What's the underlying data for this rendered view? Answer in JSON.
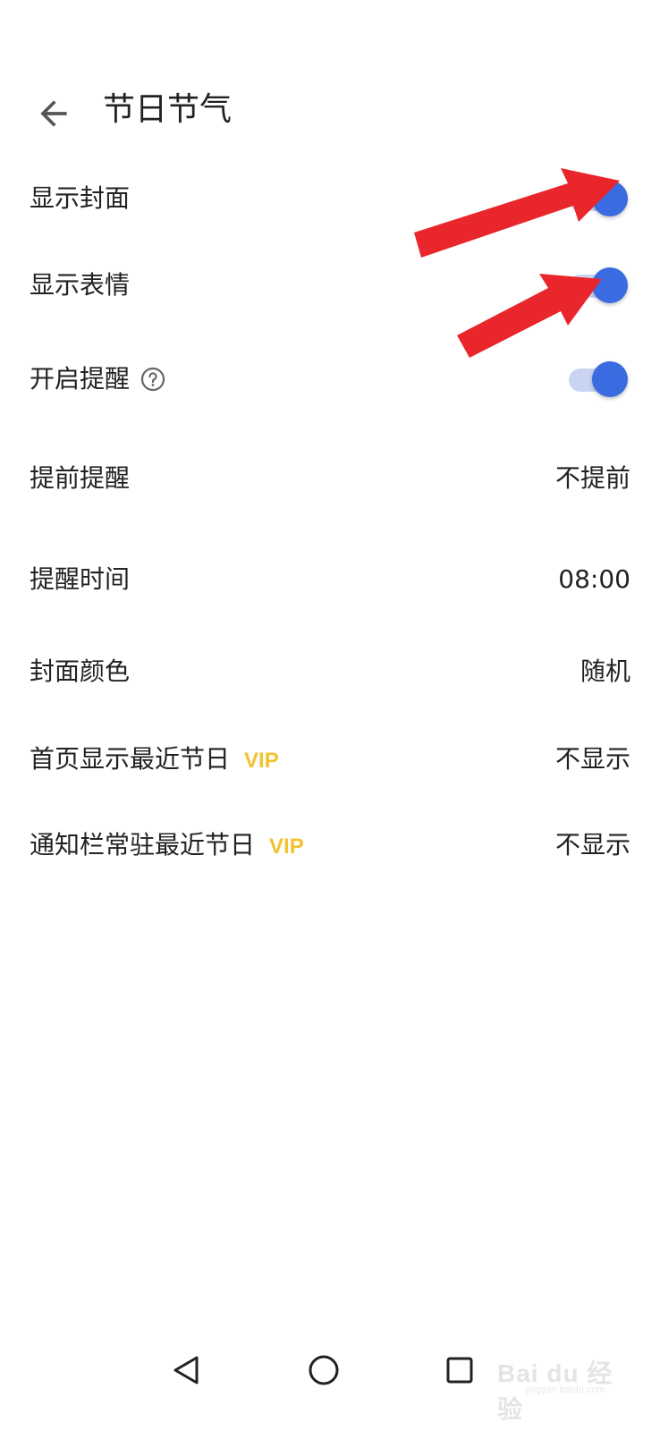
{
  "header": {
    "title": "节日节气"
  },
  "settings": [
    {
      "label": "显示封面",
      "type": "toggle",
      "on": true
    },
    {
      "label": "显示表情",
      "type": "toggle",
      "on": true
    },
    {
      "label": "开启提醒",
      "type": "toggle",
      "on": true,
      "help_icon": "help-circle-icon"
    },
    {
      "label": "提前提醒",
      "type": "value",
      "value": "不提前"
    },
    {
      "label": "提醒时间",
      "type": "value",
      "value": "08:00"
    },
    {
      "label": "封面颜色",
      "type": "value",
      "value": "随机"
    },
    {
      "label": "首页显示最近节日",
      "badge": "VIP",
      "type": "value",
      "value": "不显示"
    },
    {
      "label": "通知栏常驻最近节日",
      "badge": "VIP",
      "type": "value",
      "value": "不显示"
    }
  ],
  "colors": {
    "accent": "#3b6be0",
    "track": "#c9d4f3",
    "vip": "#f2c230",
    "annotation_arrow": "#e8262b"
  },
  "navbar": {
    "icons": [
      "back-triangle-icon",
      "home-circle-icon",
      "recents-square-icon"
    ]
  },
  "watermark": {
    "brand": "Bai du 经验",
    "sub": "jingyan.baidu.com"
  }
}
